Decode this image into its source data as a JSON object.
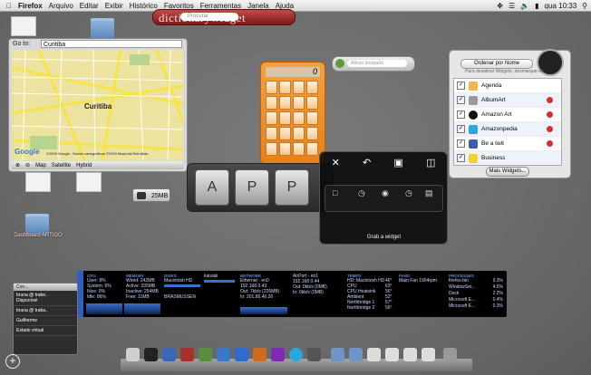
{
  "menubar": {
    "apple_icon": "apple-icon",
    "items": [
      "Firefox",
      "Arquivo",
      "Editar",
      "Exibir",
      "Histórico",
      "Favoritos",
      "Ferramentas",
      "Janela",
      "Ajuda"
    ],
    "clock": "qua 10:33",
    "status_icons": [
      "spotlight-icon",
      "wifi-icon",
      "volume-icon",
      "battery-icon",
      "bluetooth-icon"
    ]
  },
  "dictionary": {
    "title": "dictionarywidget",
    "search_placeholder": "Procurar"
  },
  "album_search": {
    "placeholder": "Álbum desejado"
  },
  "map": {
    "goto_label": "Go to:",
    "goto_value": "Curitiba",
    "city_label": "Curitiba",
    "copyright": "©2009 Google - Dados cartográficos ©2009 MapLink/Tele Atlas",
    "buttons": [
      "Map",
      "Satellite",
      "Hybrid"
    ],
    "google_logo": "Google"
  },
  "calculator": {
    "display": "0"
  },
  "desktop": {
    "icons": [
      {
        "label": "Dashboard ARTIGO",
        "type": "folder"
      }
    ],
    "drive_label": "25MB"
  },
  "app_widget": {
    "letters": [
      "A",
      "P",
      "P"
    ]
  },
  "grab": {
    "label": "Grab a widget",
    "top_icons": [
      "close-icon",
      "undo-icon",
      "save-icon",
      "book-icon"
    ]
  },
  "widget_manager": {
    "sort_label": "Ordenar por Nome",
    "hint": "Para desativar Widgets, desmarque-os.",
    "more_button": "Mais Widgets...",
    "items": [
      {
        "name": "Agenda",
        "color": "#f2b84a",
        "checked": true,
        "removable": false
      },
      {
        "name": "AlbumArt",
        "color": "#9a9a9a",
        "checked": true,
        "removable": true
      },
      {
        "name": "Amazon Art",
        "color": "#111111",
        "checked": true,
        "removable": true
      },
      {
        "name": "Amazonpedia",
        "color": "#27a9e1",
        "checked": true,
        "removable": true
      },
      {
        "name": "Be a twit",
        "color": "#3a5db0",
        "checked": true,
        "removable": true
      },
      {
        "name": "Business",
        "color": "#f4d22b",
        "checked": true,
        "removable": false
      }
    ]
  },
  "sysmon": {
    "cpu": {
      "title": "CPU",
      "lines": [
        "User: 8%",
        "System: 6%",
        "Nice: 0%",
        "Idle: 86%"
      ]
    },
    "memory": {
      "title": "MEMORY",
      "lines": [
        "Wired: 242MB",
        "Active: 335MB",
        "Inactive: 254MB",
        "Free: 11MB"
      ]
    },
    "disks": {
      "title": "DISKS",
      "name1": "Macintosh HD",
      "name2": "BRASMUSSEN",
      "name3": "kaisaki"
    },
    "network": {
      "title": "NETWORK",
      "iface1": "Ethernet - en0",
      "ip1": "192.168.0.43",
      "out1": "Out: 7kb/s (226MB)",
      "in1": "In: 201.86.46.26"
    },
    "airport": {
      "title": "AirPort - en1",
      "ip": "192.168.0.44",
      "out": "Out: 0kb/s (0MB)",
      "in": "In: 0kb/s (0MB)"
    },
    "temps": {
      "title": "TEMPS",
      "lines": [
        "HD: Macintosh HD",
        "CPU",
        "CPU Heatsink",
        "Ambient",
        "Northbridge 1",
        "Northbridge 2"
      ],
      "values": [
        "46°",
        "63°",
        "56°",
        "52°",
        "57°",
        "56°"
      ]
    },
    "fans": {
      "title": "FANS",
      "line": "Main Fan",
      "value": "1904rpm"
    },
    "processes": {
      "title": "PROCESSES",
      "items": [
        {
          "name": "firefox-bin",
          "pct": "9.3%"
        },
        {
          "name": "WindowSer...",
          "pct": "4.5%"
        },
        {
          "name": "Dock",
          "pct": "2.2%"
        },
        {
          "name": "Microsoft E...",
          "pct": "0.4%"
        },
        {
          "name": "Microsoft E...",
          "pct": "0.3%"
        }
      ]
    }
  },
  "chat": {
    "title": "Con...",
    "items": [
      {
        "name": "bruna @ trabe..",
        "status": "Disponível"
      },
      {
        "name": "bruna @ traba..",
        "status": ""
      },
      {
        "name": "Guilherme",
        "status": ""
      },
      {
        "name": "Estado virtual",
        "status": ""
      }
    ]
  },
  "add_widget_symbol": "+"
}
